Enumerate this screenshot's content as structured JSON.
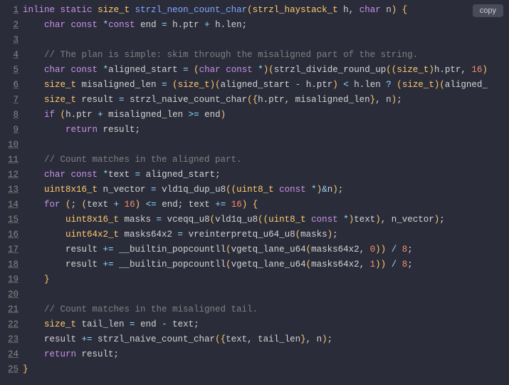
{
  "copy_label": "copy",
  "lines": [
    {
      "n": "1",
      "t": [
        {
          "c": "kw",
          "s": "inline"
        },
        {
          "s": " "
        },
        {
          "c": "kw",
          "s": "static"
        },
        {
          "s": " "
        },
        {
          "c": "typename",
          "s": "size_t"
        },
        {
          "s": " "
        },
        {
          "c": "fn",
          "s": "strzl_neon_count_char"
        },
        {
          "c": "paren",
          "s": "("
        },
        {
          "c": "typename",
          "s": "strzl_haystack_t"
        },
        {
          "s": " h, "
        },
        {
          "c": "kw",
          "s": "char"
        },
        {
          "s": " n"
        },
        {
          "c": "paren",
          "s": ")"
        },
        {
          "s": " "
        },
        {
          "c": "paren",
          "s": "{"
        }
      ]
    },
    {
      "n": "2",
      "t": [
        {
          "s": "    "
        },
        {
          "c": "kw",
          "s": "char"
        },
        {
          "s": " "
        },
        {
          "c": "kw",
          "s": "const"
        },
        {
          "s": " "
        },
        {
          "c": "op",
          "s": "*"
        },
        {
          "c": "kw",
          "s": "const"
        },
        {
          "s": " end "
        },
        {
          "c": "op",
          "s": "="
        },
        {
          "s": " h.ptr "
        },
        {
          "c": "op",
          "s": "+"
        },
        {
          "s": " h.len;"
        }
      ]
    },
    {
      "n": "3",
      "t": []
    },
    {
      "n": "4",
      "t": [
        {
          "s": "    "
        },
        {
          "c": "cmt",
          "s": "// The plan is simple: skim through the misaligned part of the string."
        }
      ]
    },
    {
      "n": "5",
      "t": [
        {
          "s": "    "
        },
        {
          "c": "kw",
          "s": "char"
        },
        {
          "s": " "
        },
        {
          "c": "kw",
          "s": "const"
        },
        {
          "s": " "
        },
        {
          "c": "op",
          "s": "*"
        },
        {
          "s": "aligned_start "
        },
        {
          "c": "op",
          "s": "="
        },
        {
          "s": " "
        },
        {
          "c": "paren",
          "s": "("
        },
        {
          "c": "kw",
          "s": "char"
        },
        {
          "s": " "
        },
        {
          "c": "kw",
          "s": "const"
        },
        {
          "s": " "
        },
        {
          "c": "op",
          "s": "*"
        },
        {
          "c": "paren",
          "s": ")("
        },
        {
          "s": "strzl_divide_round_up"
        },
        {
          "c": "paren",
          "s": "(("
        },
        {
          "c": "typename",
          "s": "size_t"
        },
        {
          "c": "paren",
          "s": ")"
        },
        {
          "s": "h.ptr, "
        },
        {
          "c": "num",
          "s": "16"
        },
        {
          "c": "paren",
          "s": ")"
        }
      ]
    },
    {
      "n": "6",
      "t": [
        {
          "s": "    "
        },
        {
          "c": "typename",
          "s": "size_t"
        },
        {
          "s": " misaligned_len "
        },
        {
          "c": "op",
          "s": "="
        },
        {
          "s": " "
        },
        {
          "c": "paren",
          "s": "("
        },
        {
          "c": "typename",
          "s": "size_t"
        },
        {
          "c": "paren",
          "s": ")("
        },
        {
          "s": "aligned_start "
        },
        {
          "c": "op",
          "s": "-"
        },
        {
          "s": " h.ptr"
        },
        {
          "c": "paren",
          "s": ")"
        },
        {
          "s": " "
        },
        {
          "c": "op",
          "s": "<"
        },
        {
          "s": " h.len "
        },
        {
          "c": "op",
          "s": "?"
        },
        {
          "s": " "
        },
        {
          "c": "paren",
          "s": "("
        },
        {
          "c": "typename",
          "s": "size_t"
        },
        {
          "c": "paren",
          "s": ")("
        },
        {
          "s": "aligned_"
        }
      ]
    },
    {
      "n": "7",
      "t": [
        {
          "s": "    "
        },
        {
          "c": "typename",
          "s": "size_t"
        },
        {
          "s": " result "
        },
        {
          "c": "op",
          "s": "="
        },
        {
          "s": " strzl_naive_count_char"
        },
        {
          "c": "paren",
          "s": "({"
        },
        {
          "s": "h.ptr, misaligned_len"
        },
        {
          "c": "paren",
          "s": "}"
        },
        {
          "s": ", n"
        },
        {
          "c": "paren",
          "s": ")"
        },
        {
          "s": ";"
        }
      ]
    },
    {
      "n": "8",
      "t": [
        {
          "s": "    "
        },
        {
          "c": "kw",
          "s": "if"
        },
        {
          "s": " "
        },
        {
          "c": "paren",
          "s": "("
        },
        {
          "s": "h.ptr "
        },
        {
          "c": "op",
          "s": "+"
        },
        {
          "s": " misaligned_len "
        },
        {
          "c": "op",
          "s": ">="
        },
        {
          "s": " end"
        },
        {
          "c": "paren",
          "s": ")"
        }
      ]
    },
    {
      "n": "9",
      "t": [
        {
          "s": "        "
        },
        {
          "c": "kw",
          "s": "return"
        },
        {
          "s": " result;"
        }
      ]
    },
    {
      "n": "10",
      "t": []
    },
    {
      "n": "11",
      "t": [
        {
          "s": "    "
        },
        {
          "c": "cmt",
          "s": "// Count matches in the aligned part."
        }
      ]
    },
    {
      "n": "12",
      "t": [
        {
          "s": "    "
        },
        {
          "c": "kw",
          "s": "char"
        },
        {
          "s": " "
        },
        {
          "c": "kw",
          "s": "const"
        },
        {
          "s": " "
        },
        {
          "c": "op",
          "s": "*"
        },
        {
          "s": "text "
        },
        {
          "c": "op",
          "s": "="
        },
        {
          "s": " aligned_start;"
        }
      ]
    },
    {
      "n": "13",
      "t": [
        {
          "s": "    "
        },
        {
          "c": "typename",
          "s": "uint8x16_t"
        },
        {
          "s": " n_vector "
        },
        {
          "c": "op",
          "s": "="
        },
        {
          "s": " vld1q_dup_u8"
        },
        {
          "c": "paren",
          "s": "(("
        },
        {
          "c": "typename",
          "s": "uint8_t"
        },
        {
          "s": " "
        },
        {
          "c": "kw",
          "s": "const"
        },
        {
          "s": " "
        },
        {
          "c": "op",
          "s": "*"
        },
        {
          "c": "paren",
          "s": ")"
        },
        {
          "c": "op",
          "s": "&"
        },
        {
          "s": "n"
        },
        {
          "c": "paren",
          "s": ")"
        },
        {
          "s": ";"
        }
      ]
    },
    {
      "n": "14",
      "t": [
        {
          "s": "    "
        },
        {
          "c": "kw",
          "s": "for"
        },
        {
          "s": " "
        },
        {
          "c": "paren",
          "s": "("
        },
        {
          "s": "; "
        },
        {
          "c": "paren",
          "s": "("
        },
        {
          "s": "text "
        },
        {
          "c": "op",
          "s": "+"
        },
        {
          "s": " "
        },
        {
          "c": "num",
          "s": "16"
        },
        {
          "c": "paren",
          "s": ")"
        },
        {
          "s": " "
        },
        {
          "c": "op",
          "s": "<="
        },
        {
          "s": " end; text "
        },
        {
          "c": "op",
          "s": "+="
        },
        {
          "s": " "
        },
        {
          "c": "num",
          "s": "16"
        },
        {
          "c": "paren",
          "s": ")"
        },
        {
          "s": " "
        },
        {
          "c": "paren",
          "s": "{"
        }
      ]
    },
    {
      "n": "15",
      "t": [
        {
          "s": "        "
        },
        {
          "c": "typename",
          "s": "uint8x16_t"
        },
        {
          "s": " masks "
        },
        {
          "c": "op",
          "s": "="
        },
        {
          "s": " vceqq_u8"
        },
        {
          "c": "paren",
          "s": "("
        },
        {
          "s": "vld1q_u8"
        },
        {
          "c": "paren",
          "s": "(("
        },
        {
          "c": "typename",
          "s": "uint8_t"
        },
        {
          "s": " "
        },
        {
          "c": "kw",
          "s": "const"
        },
        {
          "s": " "
        },
        {
          "c": "op",
          "s": "*"
        },
        {
          "c": "paren",
          "s": ")"
        },
        {
          "s": "text"
        },
        {
          "c": "paren",
          "s": ")"
        },
        {
          "s": ", n_vector"
        },
        {
          "c": "paren",
          "s": ")"
        },
        {
          "s": ";"
        }
      ]
    },
    {
      "n": "16",
      "t": [
        {
          "s": "        "
        },
        {
          "c": "typename",
          "s": "uint64x2_t"
        },
        {
          "s": " masks64x2 "
        },
        {
          "c": "op",
          "s": "="
        },
        {
          "s": " vreinterpretq_u64_u8"
        },
        {
          "c": "paren",
          "s": "("
        },
        {
          "s": "masks"
        },
        {
          "c": "paren",
          "s": ")"
        },
        {
          "s": ";"
        }
      ]
    },
    {
      "n": "17",
      "t": [
        {
          "s": "        result "
        },
        {
          "c": "op",
          "s": "+="
        },
        {
          "s": " __builtin_popcountll"
        },
        {
          "c": "paren",
          "s": "("
        },
        {
          "s": "vgetq_lane_u64"
        },
        {
          "c": "paren",
          "s": "("
        },
        {
          "s": "masks64x2, "
        },
        {
          "c": "num",
          "s": "0"
        },
        {
          "c": "paren",
          "s": "))"
        },
        {
          "s": " "
        },
        {
          "c": "op",
          "s": "/"
        },
        {
          "s": " "
        },
        {
          "c": "num",
          "s": "8"
        },
        {
          "s": ";"
        }
      ]
    },
    {
      "n": "18",
      "t": [
        {
          "s": "        result "
        },
        {
          "c": "op",
          "s": "+="
        },
        {
          "s": " __builtin_popcountll"
        },
        {
          "c": "paren",
          "s": "("
        },
        {
          "s": "vgetq_lane_u64"
        },
        {
          "c": "paren",
          "s": "("
        },
        {
          "s": "masks64x2, "
        },
        {
          "c": "num",
          "s": "1"
        },
        {
          "c": "paren",
          "s": "))"
        },
        {
          "s": " "
        },
        {
          "c": "op",
          "s": "/"
        },
        {
          "s": " "
        },
        {
          "c": "num",
          "s": "8"
        },
        {
          "s": ";"
        }
      ]
    },
    {
      "n": "19",
      "t": [
        {
          "s": "    "
        },
        {
          "c": "paren",
          "s": "}"
        }
      ]
    },
    {
      "n": "20",
      "t": []
    },
    {
      "n": "21",
      "t": [
        {
          "s": "    "
        },
        {
          "c": "cmt",
          "s": "// Count matches in the misaligned tail."
        }
      ]
    },
    {
      "n": "22",
      "t": [
        {
          "s": "    "
        },
        {
          "c": "typename",
          "s": "size_t"
        },
        {
          "s": " tail_len "
        },
        {
          "c": "op",
          "s": "="
        },
        {
          "s": " end "
        },
        {
          "c": "op",
          "s": "-"
        },
        {
          "s": " text;"
        }
      ]
    },
    {
      "n": "23",
      "t": [
        {
          "s": "    result "
        },
        {
          "c": "op",
          "s": "+="
        },
        {
          "s": " strzl_naive_count_char"
        },
        {
          "c": "paren",
          "s": "({"
        },
        {
          "s": "text, tail_len"
        },
        {
          "c": "paren",
          "s": "}"
        },
        {
          "s": ", n"
        },
        {
          "c": "paren",
          "s": ")"
        },
        {
          "s": ";"
        }
      ]
    },
    {
      "n": "24",
      "t": [
        {
          "s": "    "
        },
        {
          "c": "kw",
          "s": "return"
        },
        {
          "s": " result;"
        }
      ]
    },
    {
      "n": "25",
      "t": [
        {
          "c": "paren",
          "s": "}"
        }
      ]
    }
  ]
}
